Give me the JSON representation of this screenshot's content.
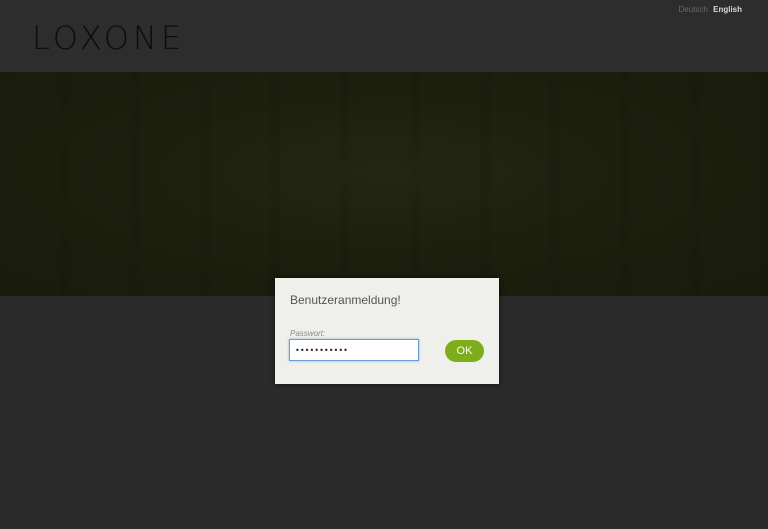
{
  "header": {
    "logo_text": "LOXONE",
    "languages": [
      {
        "label": "Deutsch",
        "active": false
      },
      {
        "label": "English",
        "active": true
      }
    ]
  },
  "dialog": {
    "title": "Benutzeranmeldung!",
    "password_label": "Passwort:",
    "password_value": "•••••••••••",
    "ok_label": "OK"
  },
  "colors": {
    "accent": "#7dad1b",
    "dialog_bg": "#efefeb",
    "page_bg": "#2a2a2a",
    "banner_bg": "#1d200d"
  }
}
